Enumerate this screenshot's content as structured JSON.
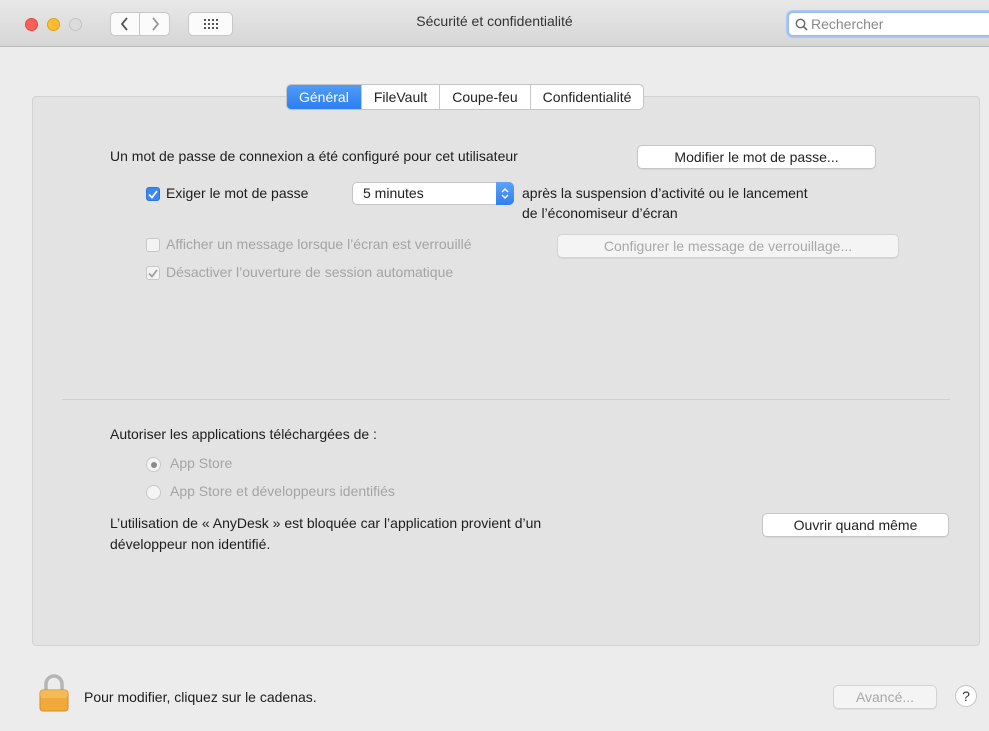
{
  "window": {
    "title": "Sécurité et confidentialité"
  },
  "search": {
    "placeholder": "Rechercher"
  },
  "tabs": [
    "Général",
    "FileVault",
    "Coupe-feu",
    "Confidentialité"
  ],
  "active_tab": "Général",
  "general": {
    "password_set_text": "Un mot de passe de connexion a été configuré pour cet utilisateur",
    "change_password_button": "Modifier le mot de passe...",
    "require_password_label": "Exiger le mot de passe",
    "require_password_checked": true,
    "require_password_delay": "5 minutes",
    "require_password_suffix_line1": "après la suspension d’activité ou le lancement",
    "require_password_suffix_line2": "de l’économiseur d’écran",
    "show_message_label": "Afficher un message lorsque l’écran est verrouillé",
    "show_message_checked": false,
    "set_lock_message_button": "Configurer le message de verrouillage...",
    "disable_autologin_label": "Désactiver l’ouverture de session automatique",
    "disable_autologin_checked": true
  },
  "downloads": {
    "heading": "Autoriser les applications téléchargées de :",
    "options": [
      "App Store",
      "App Store et développeurs identifiés"
    ],
    "selected_option": "App Store",
    "blocked_line1": "L’utilisation de « AnyDesk » est bloquée car l’application provient d’un",
    "blocked_line2": "développeur non identifié.",
    "open_anyway_button": "Ouvrir quand même"
  },
  "footer": {
    "lock_text": "Pour modifier, cliquez sur le cadenas.",
    "advanced_button": "Avancé...",
    "help_button": "?"
  },
  "colors": {
    "accent": "#2d7ef0",
    "close": "#fe5f57",
    "minimize": "#febc2e"
  }
}
